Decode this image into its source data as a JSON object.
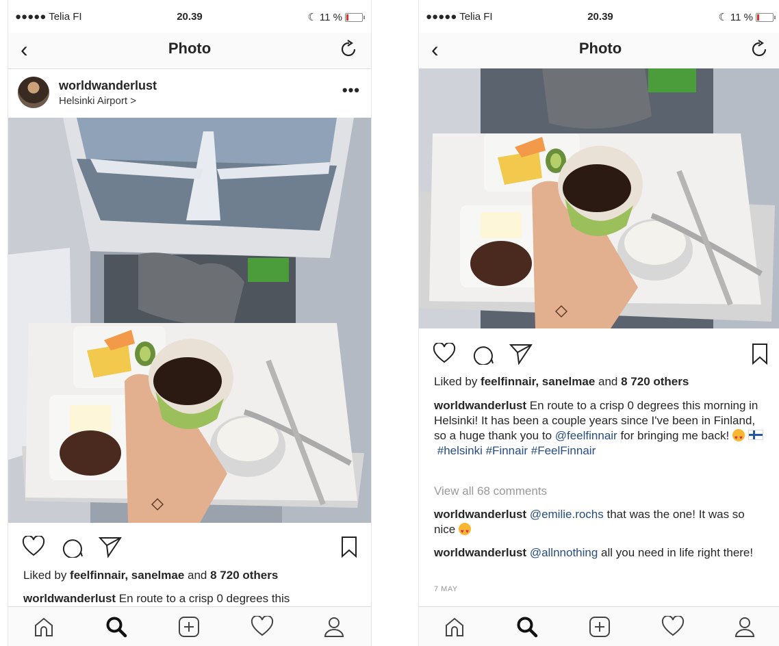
{
  "left": {
    "status": {
      "carrier": "●●●●● Telia FI",
      "time": "20.39",
      "battery": "11 %"
    },
    "nav": {
      "back": "‹",
      "title": "Photo"
    },
    "profile": {
      "username": "worldwanderlust",
      "location": "Helsinki Airport >",
      "more": "•••"
    },
    "likes": {
      "prefix": "Liked by ",
      "names": "feelfinnair, sanelmae",
      "and": " and ",
      "count": "8 720 others"
    },
    "caption": {
      "user": "worldwanderlust",
      "text": " En route to a crisp 0 degrees this"
    }
  },
  "right": {
    "status": {
      "carrier": "●●●●● Telia FI",
      "time": "20.39",
      "battery": "11 %"
    },
    "nav": {
      "back": "‹",
      "title": "Photo"
    },
    "likes": {
      "prefix": "Liked by ",
      "names": "feelfinnair, sanelmae",
      "and": " and ",
      "count": "8 720 others"
    },
    "caption": {
      "user": "worldwanderlust",
      "text": " En route to a crisp 0 degrees this morning in Helsinki! It has been a couple years since I've been in Finland, so a huge thank you to ",
      "mention": "@feelfinnair",
      "text2": " for bringing me back! ",
      "tags": "#helsinki #Finnair #FeelFinnair"
    },
    "view_all": "View all 68 comments",
    "comments": [
      {
        "user": "worldwanderlust",
        "mention": "@emilie.rochs",
        "text": " that was the one! It was so nice "
      },
      {
        "user": "worldwanderlust",
        "mention": "@allnnothing",
        "text": " all you need in life right there!"
      }
    ],
    "date": "7 MAY"
  },
  "icons": [
    "heart-icon",
    "comment-icon",
    "share-icon",
    "bookmark-icon",
    "home-icon",
    "search-icon",
    "add-icon",
    "activity-icon",
    "profile-icon",
    "refresh-icon"
  ],
  "colors": {
    "link": "#274d7f",
    "battery_low": "#e0302a",
    "muted": "#999999"
  },
  "battery_level": 0.11
}
